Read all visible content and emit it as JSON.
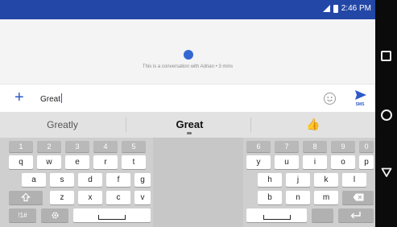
{
  "status_bar": {
    "time": "2:46 PM"
  },
  "conversation": {
    "info": "This is a conversation with Adrian • 3 mins"
  },
  "compose": {
    "text": "Great",
    "send_label": "SMS"
  },
  "suggestions": [
    "Greatly",
    "Great",
    "👍"
  ],
  "keyboard": {
    "numbers_left": [
      "1",
      "2",
      "3",
      "4",
      "5"
    ],
    "numbers_right": [
      "6",
      "7",
      "8",
      "9",
      "0"
    ],
    "row1_left": [
      "q",
      "w",
      "e",
      "r",
      "t"
    ],
    "row1_right": [
      "y",
      "u",
      "i",
      "o",
      "p"
    ],
    "row2_left": [
      "a",
      "s",
      "d",
      "f",
      "g"
    ],
    "row2_right": [
      "h",
      "j",
      "k",
      "l"
    ],
    "row3_left": [
      "z",
      "x",
      "c",
      "v"
    ],
    "row3_right": [
      "b",
      "n",
      "m"
    ],
    "symbols_label": "!1#"
  },
  "colors": {
    "status_bar": "#2347a6",
    "accent": "#2e5ac8",
    "nav_bar": "#0b0b0b"
  }
}
